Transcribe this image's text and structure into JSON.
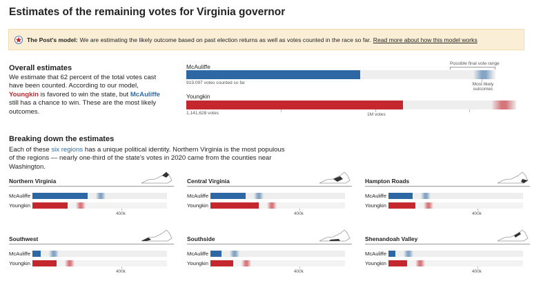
{
  "title": "Estimates of the remaining votes for Virginia governor",
  "banner": {
    "bold": "The Post's model:",
    "text": "We are estimating the likely outcome based on past election returns as well as votes counted in the race so far.",
    "link": "Read more about how this model works"
  },
  "overall": {
    "heading": "Overall estimates",
    "p1": "We estimate that 62 percent of the total votes cast have been counted. According to our model,",
    "youngkin": "Youngkin",
    "p2": "is favored to win the state, but",
    "mcauliffe": "McAuliffe",
    "p3": "still has a chance to win. These are the most likely outcomes.",
    "candidate1": "McAuliffe",
    "candidate1_counted": "919,097 votes counted so far",
    "candidate2": "Youngkin",
    "candidate2_counted": "1,141,628 votes",
    "range_label": "Possible final vote range",
    "likely_label": "Most likely outcomes",
    "axis_label": "1M votes",
    "colors": {
      "dem": "#2e68a4",
      "rep": "#c4272d"
    }
  },
  "breakdown": {
    "heading": "Breaking down the estimates",
    "p1": "Each of these",
    "link": "six regions",
    "p2": "has a unique political identity. Northern Virginia is the most populous of the regions — nearly one-third of the state's votes in 2020 came from the counties near Washington."
  },
  "regions": [
    {
      "name": "Northern Virginia",
      "c1": "McAuliffe",
      "c2": "Youngkin",
      "axis": "400k",
      "dem_frac": 0.41,
      "rep_frac": 0.26
    },
    {
      "name": "Central Virginia",
      "c1": "McAuliffe",
      "c2": "Youngkin",
      "axis": "400k",
      "dem_frac": 0.26,
      "rep_frac": 0.36
    },
    {
      "name": "Hampton Roads",
      "c1": "McAuliffe",
      "c2": "Youngkin",
      "axis": "400k",
      "dem_frac": 0.18,
      "rep_frac": 0.2
    },
    {
      "name": "Southwest",
      "c1": "McAuliffe",
      "c2": "Youngkin",
      "axis": "400k",
      "dem_frac": 0.06,
      "rep_frac": 0.18
    },
    {
      "name": "Southside",
      "c1": "McAuliffe",
      "c2": "Youngkin",
      "axis": "400k",
      "dem_frac": 0.08,
      "rep_frac": 0.17
    },
    {
      "name": "Shenandoah Valley",
      "c1": "McAuliffe",
      "c2": "Youngkin",
      "axis": "400k",
      "dem_frac": 0.05,
      "rep_frac": 0.14
    }
  ]
}
